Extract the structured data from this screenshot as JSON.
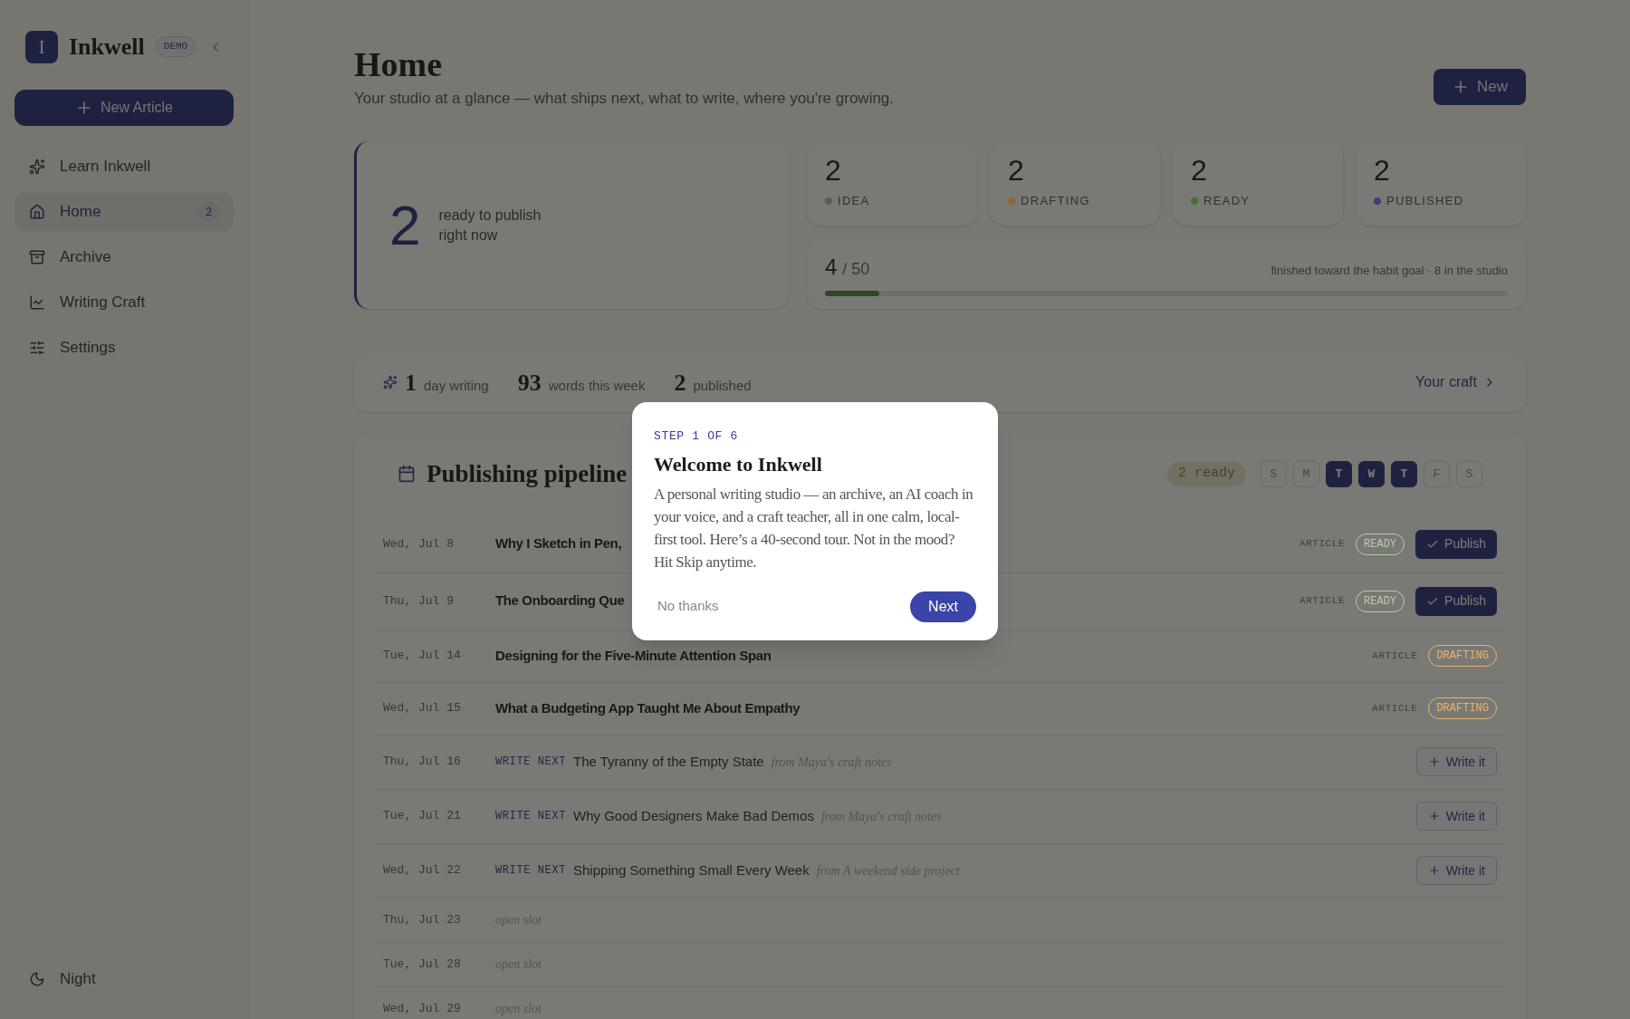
{
  "sidebar": {
    "logo_letter": "I",
    "brand": "Inkwell",
    "badge": "DEMO",
    "new_button": "New Article",
    "items": [
      {
        "label": "Learn Inkwell",
        "selected": false
      },
      {
        "label": "Home",
        "selected": true,
        "count": "2"
      },
      {
        "label": "Archive",
        "selected": false
      },
      {
        "label": "Writing Craft",
        "selected": false
      },
      {
        "label": "Settings",
        "selected": false
      }
    ],
    "footer": "Night"
  },
  "header": {
    "title": "Home",
    "subtitle": "Your studio at a glance — what ships next, what to write, where you're growing.",
    "new_button": "New"
  },
  "hero": {
    "count": "2",
    "text": "ready to publish right now"
  },
  "status_cards": [
    {
      "count": "2",
      "label": "IDEA",
      "color": "#5c5c58"
    },
    {
      "count": "2",
      "label": "DRAFTING",
      "color": "#8a6a30"
    },
    {
      "count": "2",
      "label": "READY",
      "color": "#4a6b3a"
    },
    {
      "count": "2",
      "label": "PUBLISHED",
      "color": "#3c3f7a"
    }
  ],
  "goal": {
    "done": "4",
    "total": "/ 50",
    "note": "finished toward the habit goal · 8 in the studio",
    "level": 0.08
  },
  "streak": {
    "stats": [
      {
        "value": "1",
        "label": "day writing"
      },
      {
        "value": "93",
        "label": "words this week"
      },
      {
        "value": "2",
        "label": "published"
      }
    ],
    "link": "Your craft"
  },
  "pipeline": {
    "title": "Publishing pipeline",
    "ready_badge": "2 ready",
    "days": [
      {
        "letter": "S",
        "selected": false
      },
      {
        "letter": "M",
        "selected": false
      },
      {
        "letter": "T",
        "selected": true
      },
      {
        "letter": "W",
        "selected": true
      },
      {
        "letter": "T",
        "selected": true
      },
      {
        "letter": "F",
        "selected": false
      },
      {
        "letter": "S",
        "selected": false
      }
    ],
    "rows": [
      {
        "date": "Wed, Jul 8",
        "kind": "article",
        "title": "Why I Sketch in Pen,",
        "type": "ARTICLE",
        "status": "READY",
        "color": "#b5cfa8",
        "action": "Publish"
      },
      {
        "date": "Thu, Jul 9",
        "kind": "article",
        "title": "The Onboarding Que",
        "type": "ARTICLE",
        "status": "READY",
        "color": "#b5cfa8",
        "action": "Publish"
      },
      {
        "date": "Tue, Jul 14",
        "kind": "article",
        "title": "Designing for the Five-Minute Attention Span",
        "type": "ARTICLE",
        "status": "DRAFTING",
        "color": "#e8b56a"
      },
      {
        "date": "Wed, Jul 15",
        "kind": "article",
        "title": "What a Budgeting App Taught Me About Empathy",
        "type": "ARTICLE",
        "status": "DRAFTING",
        "color": "#e8b56a"
      },
      {
        "date": "Thu, Jul 16",
        "kind": "write_next",
        "tag": "WRITE NEXT",
        "title": "The Tyranny of the Empty State",
        "source": "from Maya's craft notes",
        "action": "Write it"
      },
      {
        "date": "Tue, Jul 21",
        "kind": "write_next",
        "tag": "WRITE NEXT",
        "title": "Why Good Designers Make Bad Demos",
        "source": "from Maya's craft notes",
        "action": "Write it"
      },
      {
        "date": "Wed, Jul 22",
        "kind": "write_next",
        "tag": "WRITE NEXT",
        "title": "Shipping Something Small Every Week",
        "source": "from A weekend side project",
        "action": "Write it"
      },
      {
        "date": "Thu, Jul 23",
        "kind": "open",
        "title": "open slot"
      },
      {
        "date": "Tue, Jul 28",
        "kind": "open",
        "title": "open slot"
      },
      {
        "date": "Wed, Jul 29",
        "kind": "open",
        "title": "open slot"
      }
    ]
  },
  "tour": {
    "step": "STEP 1 OF 6",
    "title": "Welcome to Inkwell",
    "body": "A personal writing studio — an archive, an AI coach in your voice, and a craft teacher, all in one calm, local-first tool. Here’s a 40-second tour. Not in the mood? Hit Skip anytime.",
    "skip": "No thanks",
    "next": "Next"
  }
}
